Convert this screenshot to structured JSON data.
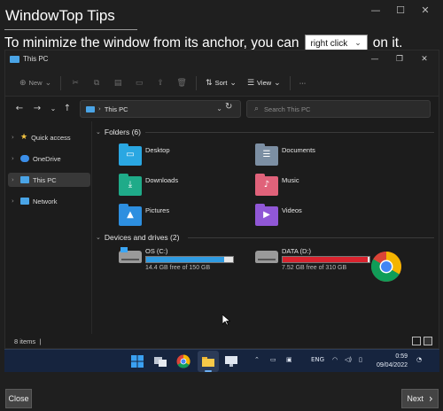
{
  "tips_window": {
    "title": "WindowTop Tips",
    "controls": {
      "minimize": "—",
      "maximize": "☐",
      "close": "✕"
    },
    "tip": {
      "text_before": "To minimize the window from its anchor, you can",
      "dropdown_value": "right click",
      "text_after": "on it."
    },
    "close_label": "Close",
    "next_label": "Next"
  },
  "explorer": {
    "title": "This PC",
    "command_bar": {
      "new_label": "New",
      "sort_label": "Sort",
      "view_label": "View",
      "more_label": "···"
    },
    "address": {
      "path": "This PC",
      "search_placeholder": "Search This PC"
    },
    "sidebar": [
      {
        "label": "Quick access",
        "icon": "star-icon",
        "color": "#f5c542"
      },
      {
        "label": "OneDrive",
        "icon": "cloud-icon",
        "color": "#3b8ee8"
      },
      {
        "label": "This PC",
        "icon": "computer-icon",
        "color": "#4aa4e6",
        "selected": true
      },
      {
        "label": "Network",
        "icon": "network-icon",
        "color": "#4aa4e6"
      }
    ],
    "folders_header": "Folders (6)",
    "folders": [
      {
        "name": "Desktop",
        "icon": "desktop-folder-icon",
        "color": "#2aa7e2"
      },
      {
        "name": "Documents",
        "icon": "documents-folder-icon",
        "color": "#7c8fa3"
      },
      {
        "name": "Downloads",
        "icon": "downloads-folder-icon",
        "color": "#1fab89"
      },
      {
        "name": "Music",
        "icon": "music-folder-icon",
        "color": "#e0627a"
      },
      {
        "name": "Pictures",
        "icon": "pictures-folder-icon",
        "color": "#2d8fe0"
      },
      {
        "name": "Videos",
        "icon": "videos-folder-icon",
        "color": "#9057d6"
      }
    ],
    "drives_header": "Devices and drives (2)",
    "drives": [
      {
        "name": "OS (C:)",
        "free": "14.4 GB free of 150 GB",
        "used_fraction": 0.9,
        "bar_color": "#2f9be2"
      },
      {
        "name": "DATA (D:)",
        "free": "7.52 GB free of 310 GB",
        "used_fraction": 0.98,
        "bar_color": "#d9232e"
      }
    ],
    "status": {
      "items": "8 items",
      "cursor": "|"
    }
  },
  "taskbar": {
    "language": "ENG",
    "time": "0:59",
    "date": "09/04/2022"
  }
}
